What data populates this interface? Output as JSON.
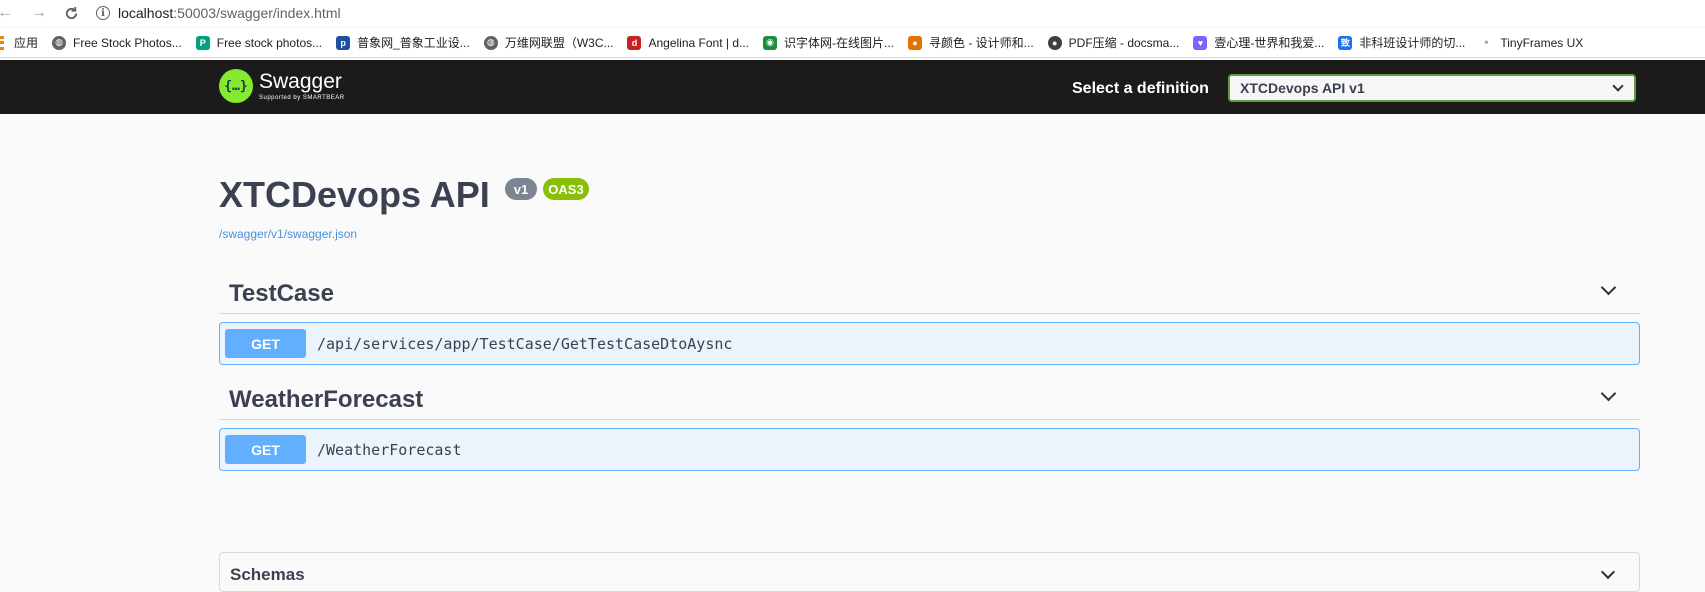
{
  "browser": {
    "url_host": "localhost",
    "url_path": ":50003/swagger/index.html"
  },
  "bookmarks": [
    {
      "label": "应用",
      "icon": "apps-icon",
      "color": "#ea8600"
    },
    {
      "label": "Free Stock Photos...",
      "icon": "globe-icon",
      "color": "#5f6368"
    },
    {
      "label": "Free stock photos...",
      "icon": "pexels-icon",
      "color": "#05a081"
    },
    {
      "label": "普象网_普象工业设...",
      "icon": "puxiang-icon",
      "color": "#1f4fa0"
    },
    {
      "label": "万维网联盟（W3C...",
      "icon": "globe-icon",
      "color": "#5f6368"
    },
    {
      "label": "Angelina Font | d...",
      "icon": "dafont-icon",
      "color": "#c5221f"
    },
    {
      "label": "识字体网-在线图片...",
      "icon": "eye-icon",
      "color": "#1e8e3e"
    },
    {
      "label": "寻颜色 - 设计师和...",
      "icon": "color-icon",
      "color": "#e37400"
    },
    {
      "label": "PDF压缩 - docsma...",
      "icon": "pdf-icon",
      "color": "#3c4043"
    },
    {
      "label": "壹心理-世界和我爱...",
      "icon": "heart-icon",
      "color": "#7b61ff"
    },
    {
      "label": "非科班设计师的切...",
      "icon": "zhi-icon",
      "color": "#1a73e8"
    },
    {
      "label": "TinyFrames UX",
      "icon": "link-icon",
      "color": "#1a73e8"
    }
  ],
  "topbar": {
    "logo_title": "Swagger",
    "logo_sub": "Supported by SMARTBEAR",
    "definition_label": "Select a definition",
    "definition_value": "XTCDevops API v1"
  },
  "info": {
    "title": "XTCDevops API",
    "version_badge": "v1",
    "oas_badge": "OAS3",
    "spec_link": "/swagger/v1/swagger.json"
  },
  "tags": [
    {
      "name": "TestCase",
      "method": "GET",
      "path": "/api/services/app/TestCase/GetTestCaseDtoAysnc"
    },
    {
      "name": "WeatherForecast",
      "method": "GET",
      "path": "/WeatherForecast"
    }
  ],
  "schemas": {
    "title": "Schemas"
  }
}
